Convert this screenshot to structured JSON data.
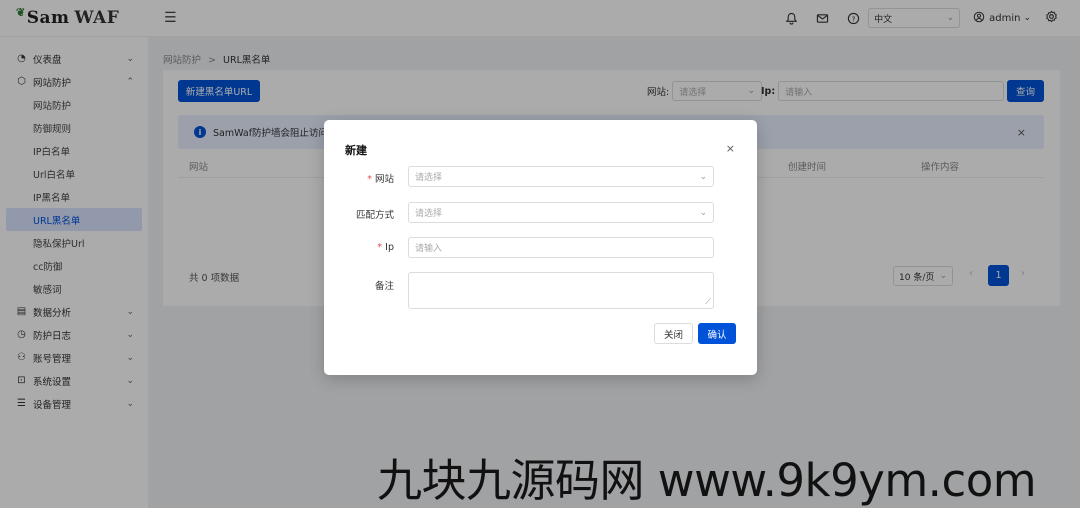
{
  "header": {
    "logo_text": "Sam",
    "logo_waf": "WAF",
    "menu_icon": "hamburger-icon",
    "icons": [
      "bell-icon",
      "mail-icon",
      "help-icon"
    ],
    "language": "中文",
    "user": "admin",
    "settings_icon": "gear-icon"
  },
  "sidebar": {
    "items": [
      {
        "label": "仪表盘",
        "icon": "dashboard-icon",
        "chevron": "⌄"
      },
      {
        "label": "网站防护",
        "icon": "shield-icon",
        "chevron": "⌃"
      },
      {
        "label": "网站防护"
      },
      {
        "label": "防御规则"
      },
      {
        "label": "IP白名单"
      },
      {
        "label": "Url白名单"
      },
      {
        "label": "IP黑名单"
      },
      {
        "label": "URL黑名单"
      },
      {
        "label": "隐私保护Url"
      },
      {
        "label": "cc防御"
      },
      {
        "label": "敏感词"
      },
      {
        "label": "数据分析",
        "icon": "chart-icon",
        "chevron": "⌄"
      },
      {
        "label": "防护日志",
        "icon": "log-icon",
        "chevron": "⌄"
      },
      {
        "label": "账号管理",
        "icon": "users-icon",
        "chevron": "⌄"
      },
      {
        "label": "系统设置",
        "icon": "system-icon",
        "chevron": "⌄"
      },
      {
        "label": "设备管理",
        "icon": "device-icon",
        "chevron": "⌄"
      }
    ]
  },
  "breadcrumb": {
    "parent": "网站防护",
    "separator": ">",
    "current": "URL黑名单"
  },
  "toolbar": {
    "new_button": "新建黑名单URL",
    "site_label": "网站:",
    "site_placeholder": "请选择",
    "ip_label": "Ip:",
    "ip_placeholder": "请输入",
    "query_button": "查询"
  },
  "alert": {
    "text": "SamWaf防护墙会阻止访问名",
    "close": "×"
  },
  "table": {
    "headers": [
      "网站",
      "创建时间",
      "操作内容"
    ]
  },
  "pagination": {
    "total": "共 0 项数据",
    "page_size": "10 条/页",
    "prev": "‹",
    "current": "1",
    "next": "›"
  },
  "dialog": {
    "title": "新建",
    "close": "×",
    "fields": [
      {
        "label": "网站",
        "required": "*",
        "placeholder": "请选择"
      },
      {
        "label": "匹配方式",
        "required": "",
        "placeholder": "请选择"
      },
      {
        "label": "Ip",
        "required": "*",
        "placeholder": "请输入"
      },
      {
        "label": "备注",
        "required": "",
        "placeholder": ""
      }
    ],
    "cancel": "关闭",
    "confirm": "确认"
  },
  "watermark": "九块九源码网 www.9k9ym.com",
  "colors": {
    "primary": "#0052d9",
    "active_bg": "#d9e4ff",
    "alert_bg": "#e8efff",
    "required": "#e34d59"
  }
}
